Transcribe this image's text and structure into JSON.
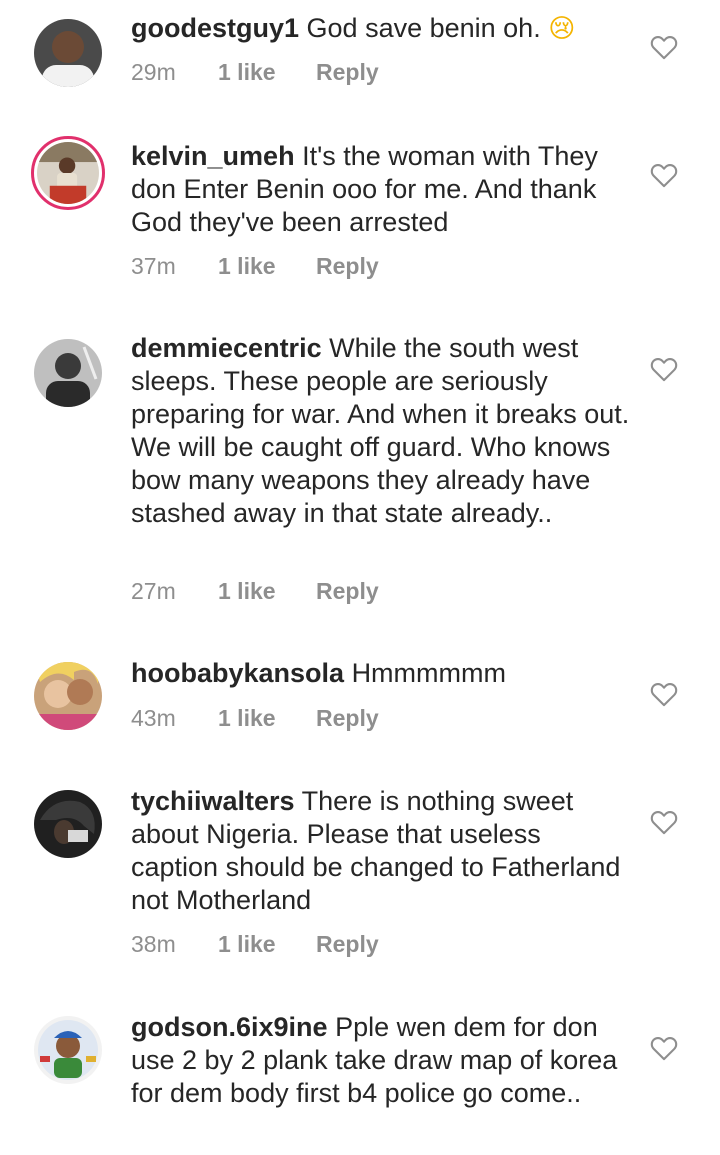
{
  "comments": [
    {
      "username": "goodestguy1",
      "text": "God save benin oh.",
      "emoji": "😢",
      "time": "29m",
      "likes": "1 like",
      "reply": "Reply"
    },
    {
      "username": "kelvin_umeh",
      "text": "It's the woman with They don Enter Benin ooo for me. And thank God they've been arrested",
      "time": "37m",
      "likes": "1 like",
      "reply": "Reply"
    },
    {
      "username": "demmiecentric",
      "text": "While the south west sleeps. These people are seriously preparing for war. And when it breaks out. We will be caught off guard. Who knows bow many weapons they already have stashed away in that state already..",
      "time": "27m",
      "likes": "1 like",
      "reply": "Reply"
    },
    {
      "username": "hoobabykansola",
      "text": "Hmmmmmm",
      "time": "43m",
      "likes": "1 like",
      "reply": "Reply"
    },
    {
      "username": "tychiiwalters",
      "text": "There is nothing sweet about Nigeria. Please that useless caption should be changed to Fatherland not Motherland",
      "time": "38m",
      "likes": "1 like",
      "reply": "Reply"
    },
    {
      "username": "godson.6ix9ine",
      "text": "Pple wen dem for don use 2 by 2 plank take draw map of korea for dem body first b4 police go come..",
      "time": "",
      "likes": "",
      "reply": ""
    }
  ],
  "icons": {
    "like": "heart-outline-icon"
  },
  "colors": {
    "muted": "#8e8e8e",
    "story_ring": "#e1306c",
    "text": "#262626"
  }
}
